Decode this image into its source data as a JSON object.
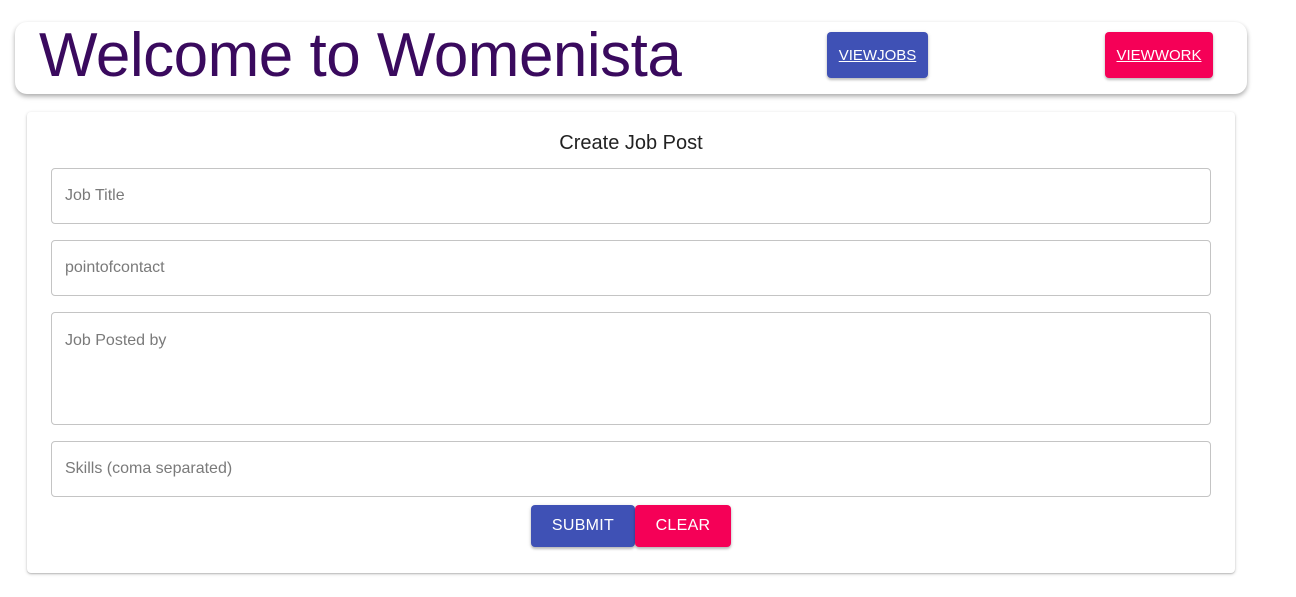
{
  "colors": {
    "title": "#3a0a5e",
    "primary": "#3f51b5",
    "secondary": "#f50057"
  },
  "header": {
    "title": "Welcome to Womenista",
    "view_jobs_label": "VIEWJOBS",
    "view_work_label": "VIEWWORK"
  },
  "form": {
    "heading": "Create Job Post",
    "job_title_placeholder": "Job Title",
    "point_of_contact_placeholder": "pointofcontact",
    "posted_by_placeholder": "Job Posted by",
    "skills_placeholder": "Skills (coma separated)",
    "submit_label": "SUBMIT",
    "clear_label": "CLEAR"
  }
}
